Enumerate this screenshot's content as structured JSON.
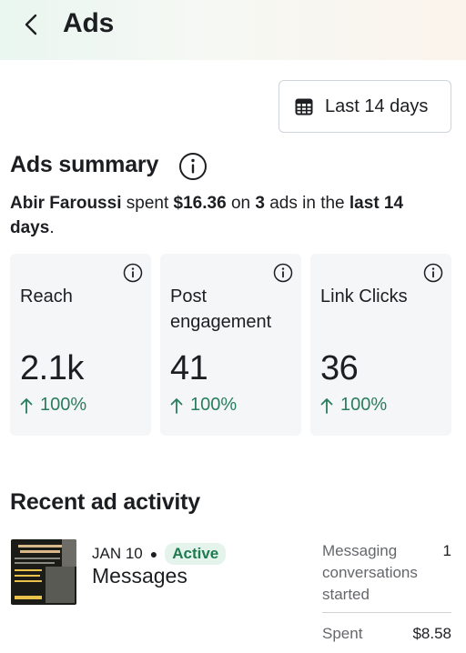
{
  "header": {
    "title": "Ads",
    "back_icon": "chevron-left-icon"
  },
  "date_filter": {
    "label": "Last 14 days",
    "icon": "calendar-icon"
  },
  "summary": {
    "title": "Ads summary",
    "info_icon": "info-icon",
    "name": "Abir Faroussi",
    "spent_word": "spent",
    "amount": "$16.36",
    "on_word": "on",
    "count": "3",
    "ads_word": "ads in the",
    "period": "last 14 days",
    "end": "."
  },
  "metrics": [
    {
      "label": "Reach",
      "value": "2.1k",
      "change": "100%"
    },
    {
      "label": "Post engagement",
      "value": "41",
      "change": "100%"
    },
    {
      "label": "Link Clicks",
      "value": "36",
      "change": "100%"
    }
  ],
  "colors": {
    "positive": "#2a7d5d",
    "badge_bg": "#e4f4ec",
    "badge_text": "#1f7a50"
  },
  "recent": {
    "title": "Recent ad activity",
    "items": [
      {
        "date": "JAN 10",
        "status": "Active",
        "name": "Messages",
        "stat_label": "Messaging conversations started",
        "stat_value": "1",
        "spent_label": "Spent",
        "spent_value": "$8.58"
      }
    ]
  }
}
